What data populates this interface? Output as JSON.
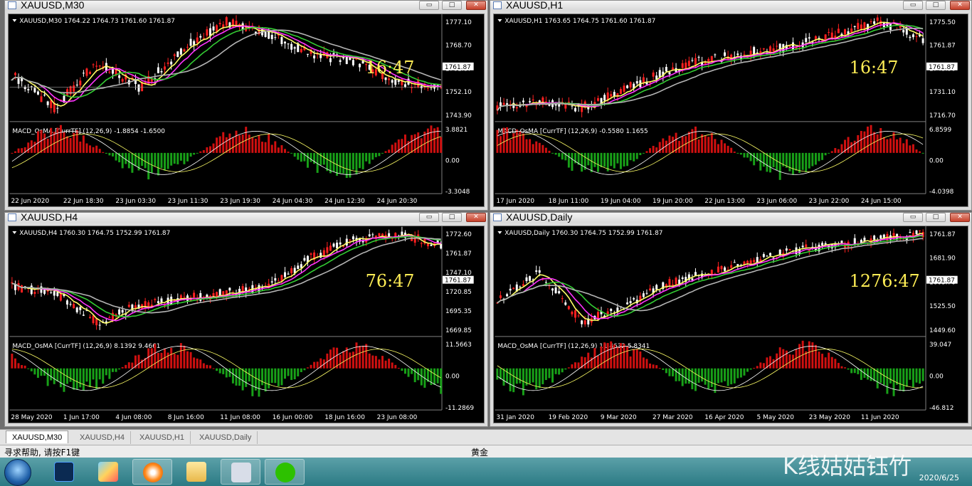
{
  "windows": [
    {
      "title": "XAUUSD,M30",
      "header": "XAUUSD,M30  1764.22 1764.73 1761.60 1761.87",
      "price_label": "1761.87",
      "timer": "16:47",
      "prices": [
        "1777.10",
        "1768.70",
        "1761.87",
        "1752.10",
        "1743.90"
      ],
      "macd_label": "MACD_OsMA [CurrTF] (12,26,9) -1.8854 -1.6500",
      "macd_values": [
        "3.8821",
        "0.00",
        "-3.3048"
      ],
      "dates": [
        "22 Jun 2020",
        "22 Jun 18:30",
        "23 Jun 03:30",
        "23 Jun 11:30",
        "23 Jun 19:30",
        "24 Jun 04:30",
        "24 Jun 12:30",
        "24 Jun 20:30"
      ]
    },
    {
      "title": "XAUUSD,H1",
      "header": "XAUUSD,H1  1763.65 1764.75 1761.60 1761.87",
      "price_label": "1761.87",
      "timer": "16:47",
      "prices": [
        "1775.50",
        "1761.87",
        "1745.90",
        "1731.10",
        "1716.70"
      ],
      "macd_label": "MACD_OsMA [CurrTF] (12,26,9) -0.5580 1.1655",
      "macd_values": [
        "6.8599",
        "0.00",
        "-4.0398"
      ],
      "dates": [
        "17 Jun 2020",
        "18 Jun 11:00",
        "19 Jun 04:00",
        "19 Jun 20:00",
        "22 Jun 13:00",
        "23 Jun 06:00",
        "23 Jun 22:00",
        "24 Jun 15:00"
      ]
    },
    {
      "title": "XAUUSD,H4",
      "header": "XAUUSD,H4  1760.30 1764.75 1752.99 1761.87",
      "price_label": "1761.87",
      "timer": "76:47",
      "prices": [
        "1772.60",
        "1761.87",
        "1747.10",
        "1720.85",
        "1695.35",
        "1669.85"
      ],
      "macd_label": "MACD_OsMA [CurrTF] (12,26,9) 8.1392 9.4661",
      "macd_values": [
        "11.5663",
        "0.00",
        "-11.2869"
      ],
      "dates": [
        "28 May 2020",
        "1 Jun 17:00",
        "4 Jun 08:00",
        "8 Jun 16:00",
        "11 Jun 08:00",
        "16 Jun 00:00",
        "18 Jun 16:00",
        "23 Jun 08:00"
      ]
    },
    {
      "title": "XAUUSD,Daily",
      "header": "XAUUSD,Daily  1760.30 1764.75 1752.99 1761.87",
      "price_label": "1761.87",
      "timer": "1276:47",
      "prices": [
        "1761.87",
        "1681.90",
        "1603.70",
        "1525.50",
        "1449.60"
      ],
      "macd_label": "MACD_OsMA [CurrTF] (12,26,9) 11.4632 5.8341",
      "macd_values": [
        "39.047",
        "0.00",
        "-46.812"
      ],
      "dates": [
        "31 Jan 2020",
        "19 Feb 2020",
        "9 Mar 2020",
        "27 Mar 2020",
        "16 Apr 2020",
        "5 May 2020",
        "23 May 2020",
        "11 Jun 2020"
      ]
    }
  ],
  "window_buttons": {
    "minimize": "▭",
    "maximize": "□",
    "close": "✕"
  },
  "tabs": [
    "XAUUSD,M30",
    "XAUUSD,H4",
    "XAUUSD,H1",
    "XAUUSD,Daily"
  ],
  "status": {
    "help": "寻求帮助, 请按F1键",
    "profile": "黄金"
  },
  "taskbar": {
    "date": "2020/6/25",
    "apps": [
      "photoshop-icon",
      "paint-icon",
      "browser-icon",
      "folder-icon",
      "mt4-icon",
      "wechat-icon"
    ]
  },
  "watermark": "K线姑姑钰竹",
  "colors": {
    "bull": "#ffffff",
    "bear": "#ff0000",
    "ma_yellow": "#ffff66",
    "ma_magenta": "#ff33ff",
    "ma_green": "#33cc33",
    "ma_grey": "#b4b4b4",
    "timer": "#ffee55"
  }
}
